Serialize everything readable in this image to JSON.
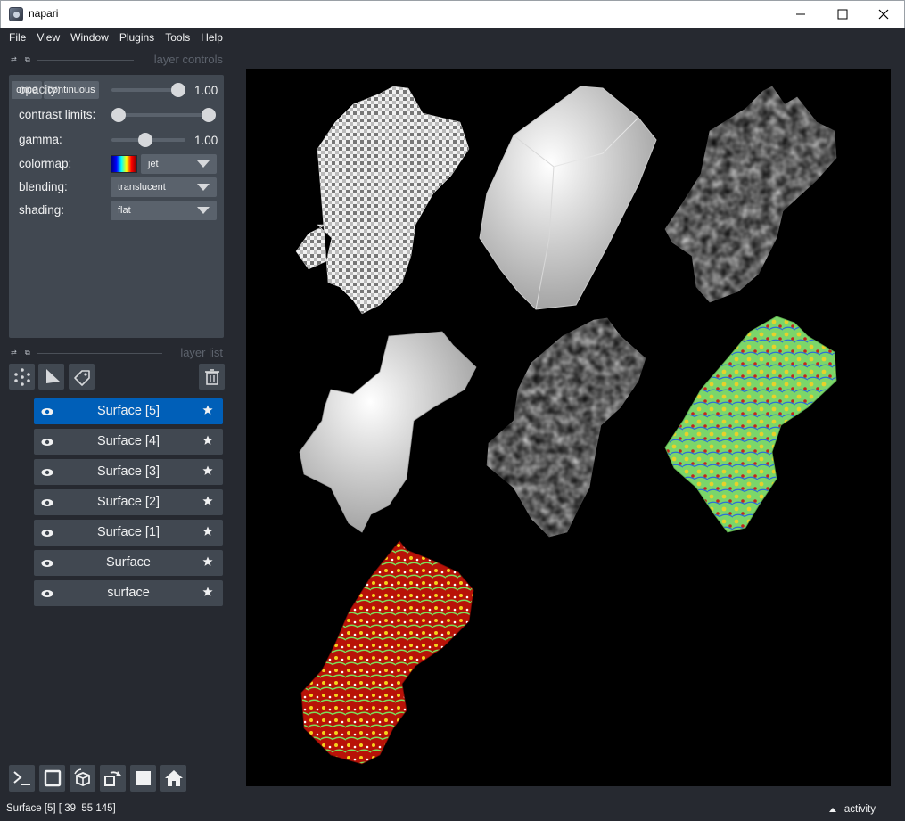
{
  "window": {
    "title": "napari"
  },
  "menu": [
    "File",
    "View",
    "Window",
    "Plugins",
    "Tools",
    "Help"
  ],
  "layer_controls": {
    "header": "layer controls",
    "buttons": [
      "once",
      "continuous"
    ],
    "opacity_label": "opacity:",
    "opacity_value": "1.00",
    "contrast_label": "contrast limits:",
    "gamma_label": "gamma:",
    "gamma_value": "1.00",
    "colormap_label": "colormap:",
    "colormap_value": "jet",
    "blending_label": "blending:",
    "blending_value": "translucent",
    "shading_label": "shading:",
    "shading_value": "flat"
  },
  "layer_list": {
    "header": "layer list",
    "layers": [
      "Surface [5]",
      "Surface [4]",
      "Surface [3]",
      "Surface [2]",
      "Surface [1]",
      "Surface",
      "surface"
    ]
  },
  "status": {
    "text": "Surface [5] [ 39  55 145]",
    "activity": "activity"
  },
  "colors": {
    "background": "#262930",
    "panel": "#414851",
    "selected": "#005fb8",
    "canvas": "#000000"
  }
}
